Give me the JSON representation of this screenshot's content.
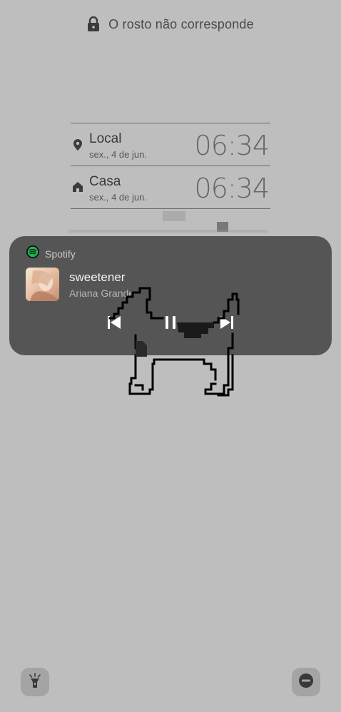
{
  "lock_status": {
    "text": "O rosto não corresponde",
    "icon": "lock-icon"
  },
  "world_clock": [
    {
      "city": "Local",
      "date": "sex., 4 de jun.",
      "time": "06:34",
      "icon": "location-pin-icon"
    },
    {
      "city": "Casa",
      "date": "sex., 4 de jun.",
      "time": "06:34",
      "icon": "home-icon"
    }
  ],
  "media": {
    "app": "Spotify",
    "app_icon": "spotify-icon",
    "title": "sweetener",
    "artist": "Ariana Grande",
    "state": "playing"
  },
  "shortcuts": {
    "left": "flashlight-icon",
    "right": "do-not-disturb-icon"
  },
  "colors": {
    "background": "#bebebe",
    "media_card": "#555555",
    "spotify_green": "#1db954"
  }
}
